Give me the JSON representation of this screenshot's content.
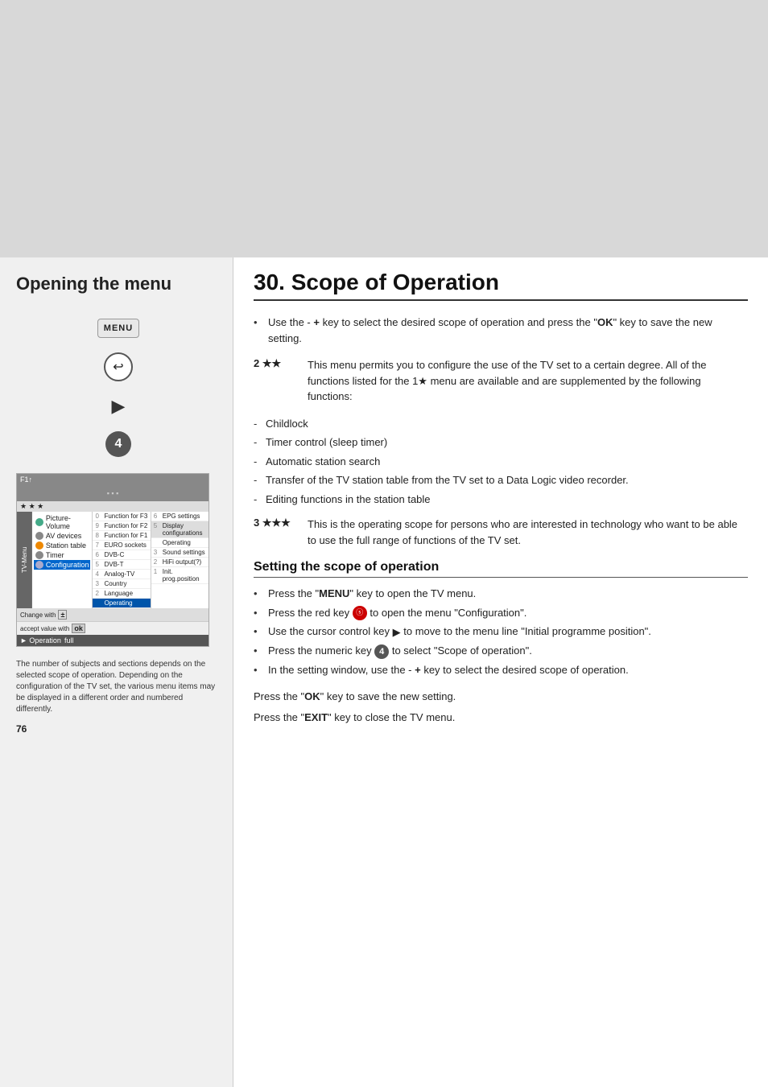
{
  "page": {
    "background_top": "gray area",
    "page_number": "76"
  },
  "left_panel": {
    "title": "Opening the menu",
    "menu_label": "MENU",
    "footnote": "The number of subjects and sections depends on the selected scope of operation. Depending on the configuration of the TV set, the various menu items may be displayed in a different order and numbered differently.",
    "tv_menu": {
      "header_label": "F1↑",
      "items": [
        {
          "num": "0",
          "label": "Function for F3"
        },
        {
          "num": "9",
          "label": "Function for F2"
        },
        {
          "num": "8",
          "label": "Function for F1"
        },
        {
          "num": "7",
          "label": "EURO sockets"
        },
        {
          "num": "6",
          "label": "DVB-C"
        },
        {
          "num": "5",
          "label": "DVB-T"
        },
        {
          "num": "4",
          "label": "Analog-TV"
        },
        {
          "num": "3",
          "label": "Country"
        },
        {
          "num": "2",
          "label": "Language"
        },
        {
          "num": "",
          "label": "Operating"
        }
      ],
      "left_sidebar_items": [
        "Picture-Volume",
        "AV devices",
        "Station table",
        "Timer",
        "Configuration"
      ],
      "right_col_items": [
        {
          "num": "6",
          "label": "EPG settings"
        },
        {
          "num": "5",
          "label": "Display configurations"
        },
        {
          "num": "",
          "label": "Operating"
        },
        {
          "num": "3",
          "label": "Sound settings"
        },
        {
          "num": "2",
          "label": "HiFi output(?)"
        },
        {
          "num": "1",
          "label": "Init. prog.position"
        }
      ],
      "footer1": "Change with",
      "footer2": "accept value with",
      "operation_label": "► Operation",
      "operation_value": "full"
    }
  },
  "right_panel": {
    "title": "30. Scope of Operation",
    "intro_bullets": [
      "Use the - + key to select the desired scope of operation and press the \"OK\" key to save the new setting."
    ],
    "star2_label": "2 ★★",
    "star2_text": "This menu permits you to configure the use of the TV set to a certain degree. All of the functions listed for the 1★ menu are available and are supplemented by the following functions:",
    "dash_items": [
      "Childlock",
      "Timer control (sleep timer)",
      "Automatic station search",
      "Transfer of the TV station table from the TV set to a Data Logic video recorder.",
      "Editing functions in the station table"
    ],
    "star3_label": "3 ★★★",
    "star3_text": "This is the operating scope for persons who are interested in technology who want to be able to use the full range of functions of the TV set.",
    "sub_section_title": "Setting the scope of operation",
    "sub_bullets": [
      "Press the \"MENU\" key to open the TV menu.",
      "Press the red key ⓢ to open the menu \"Configuration\".",
      "Use the cursor control key ► to move to the menu line \"Initial programme position\".",
      "Press the numeric key ④ to select \"Scope of operation\".",
      "In the setting window, use the - + key to select the desired scope of operation."
    ],
    "para1": "Press the \"OK\" key to save the new setting.",
    "para2": "Press the \"EXIT\" key to close the TV menu."
  }
}
